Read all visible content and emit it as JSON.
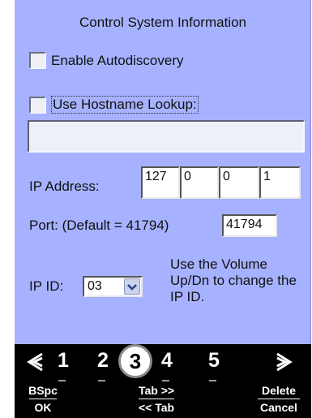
{
  "title": "Control System Information",
  "enable_autodiscovery": {
    "label": "Enable Autodiscovery",
    "checked": false
  },
  "use_hostname_lookup": {
    "label": "Use Hostname Lookup:",
    "checked": false
  },
  "hostname": {
    "value": ""
  },
  "ip_address": {
    "label": "IP Address:",
    "octets": [
      "127",
      "0",
      "0",
      "1"
    ]
  },
  "port": {
    "label": "Port: (Default = 41794)",
    "value": "41794"
  },
  "ip_id": {
    "label": "IP ID:",
    "value": "03",
    "help": "Use the Volume Up/Dn to change the IP ID."
  },
  "nav": {
    "prev_icon": "left-chevron-icon",
    "next_icon": "right-chevron-icon",
    "digits": [
      "1",
      "2",
      "3",
      "4",
      "5"
    ],
    "selected": "3"
  },
  "softkeys": {
    "left_top": "BSpc",
    "left_bottom": "OK",
    "mid_top": "Tab >>",
    "mid_bottom": "<< Tab",
    "right_top": "Delete",
    "right_bottom": "Cancel"
  },
  "colors": {
    "panel": "#a6b2ff",
    "bottom_bar": "#000000"
  }
}
